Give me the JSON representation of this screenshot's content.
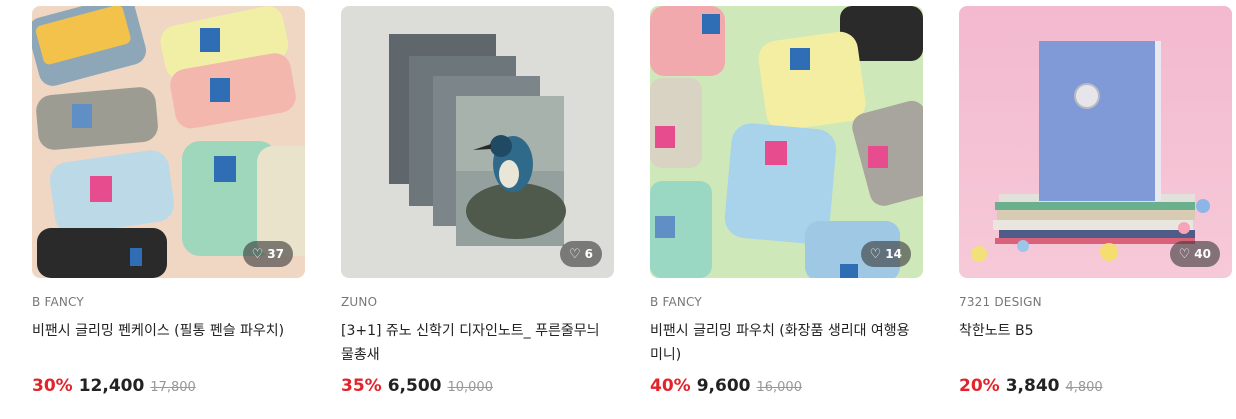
{
  "products": [
    {
      "brand": "B FANCY",
      "name": "비팬시 글리밍 펜케이스 (필통 펜슬 파우치)",
      "likes": "37",
      "discount": "30%",
      "price": "12,400",
      "original_price": "17,800"
    },
    {
      "brand": "ZUNO",
      "name": "[3+1] 쥬노 신학기 디자인노트_ 푸른줄무늬물총새",
      "likes": "6",
      "discount": "35%",
      "price": "6,500",
      "original_price": "10,000"
    },
    {
      "brand": "B FANCY",
      "name": "비팬시 글리밍 파우치 (화장품 생리대 여행용 미니)",
      "likes": "14",
      "discount": "40%",
      "price": "9,600",
      "original_price": "16,000"
    },
    {
      "brand": "7321 DESIGN",
      "name": "착한노트 B5",
      "likes": "40",
      "discount": "20%",
      "price": "3,840",
      "original_price": "4,800"
    }
  ],
  "icons": {
    "like": "heart-icon"
  },
  "colors": {
    "discount": "#e2232b",
    "like_badge": "#3c3c3c"
  }
}
